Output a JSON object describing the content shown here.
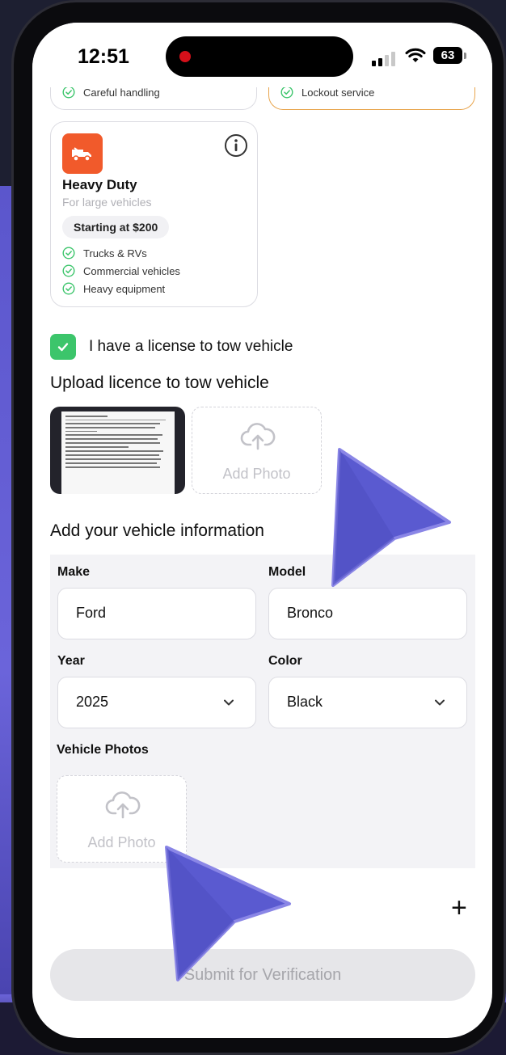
{
  "status_bar": {
    "time": "12:51",
    "battery": "63"
  },
  "top_cards": {
    "left_feature": "Careful handling",
    "right_feature": "Lockout service"
  },
  "heavy_duty": {
    "title": "Heavy Duty",
    "subtitle": "For large vehicles",
    "price": "Starting at $200",
    "features": [
      "Trucks & RVs",
      "Commercial vehicles",
      "Heavy equipment"
    ]
  },
  "license_checkbox": {
    "label": "I have a license to tow vehicle",
    "checked": true
  },
  "upload_section": {
    "title": "Upload licence to tow vehicle",
    "add_photo_label": "Add Photo"
  },
  "vehicle_section": {
    "title": "Add your vehicle information",
    "make_label": "Make",
    "make_value": "Ford",
    "model_label": "Model",
    "model_value": "Bronco",
    "year_label": "Year",
    "year_value": "2025",
    "color_label": "Color",
    "color_value": "Black",
    "photos_label": "Vehicle Photos",
    "add_photo_label": "Add Photo"
  },
  "add_button": "+",
  "submit_button": "Submit for Verification",
  "colors": {
    "accent_orange": "#f15a2b",
    "check_green": "#3cc56b",
    "selected_border": "#e8a44c",
    "cursor_purple": "#5b5bd6"
  },
  "icons": [
    "truck-icon",
    "info-icon",
    "check-circle-icon",
    "cloud-upload-icon",
    "chevron-down-icon",
    "plus-icon"
  ]
}
